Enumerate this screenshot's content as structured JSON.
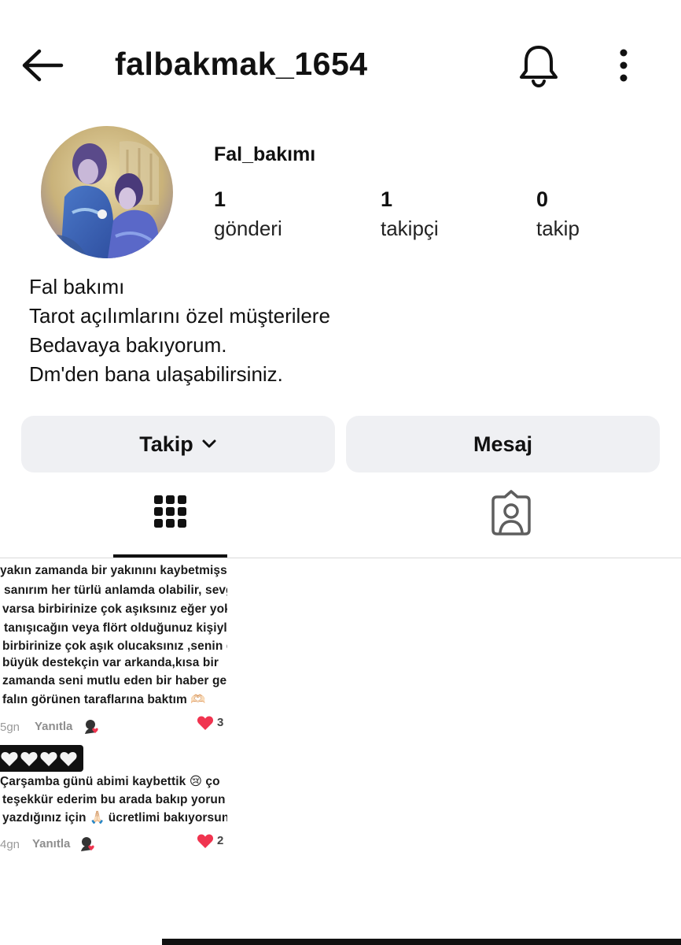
{
  "header": {
    "username": "falbakmak_1654"
  },
  "profile": {
    "display_name": "Fal_bakımı",
    "stats": {
      "posts": {
        "count": "1",
        "label": "gönderi"
      },
      "followers": {
        "count": "1",
        "label": "takipçi"
      },
      "following": {
        "count": "0",
        "label": "takip"
      }
    },
    "bio": [
      "Fal bakımı",
      "Tarot açılımlarını özel müşterilere",
      "Bedavaya bakıyorum.",
      "Dm'den bana ulaşabilirsiniz."
    ]
  },
  "actions": {
    "follow_label": "Takip",
    "message_label": "Mesaj"
  },
  "tabs": {
    "active": "grid",
    "icons": [
      "grid-icon",
      "tagged-person-icon"
    ]
  },
  "post": {
    "comment1": {
      "lines": [
        "yakın zamanda bir yakınını kaybetmişs",
        "sanırım her türlü anlamda olabilir, sevg",
        "varsa birbirinize çok aşıksınız eğer yok",
        "tanışıcağın veya flört olduğunuz kişiyl",
        "birbirinize çok aşık olucaksınız ,senin d",
        "büyük destekçin var arkanda,kısa bir",
        "zamanda seni mutlu eden bir haber ge",
        "falın görünen taraflarına baktım 🫶🏻"
      ],
      "time": "5gn",
      "reply": "Yanıtla",
      "likes": "3"
    },
    "comment2": {
      "badge": "🤍🤍🤍🤍",
      "lines": [
        "Çarşamba günü abimi kaybettik 😢 ço",
        "teşekkür ederim bu arada bakıp yorun",
        "yazdığınız için 🙏🏻 ücretlimi bakıyorsun"
      ],
      "time": "4gn",
      "reply": "Yanıtla",
      "likes": "2"
    }
  },
  "colors": {
    "button_bg": "#eff0f3",
    "like_heart": "#f0344f",
    "text": "#111111"
  }
}
